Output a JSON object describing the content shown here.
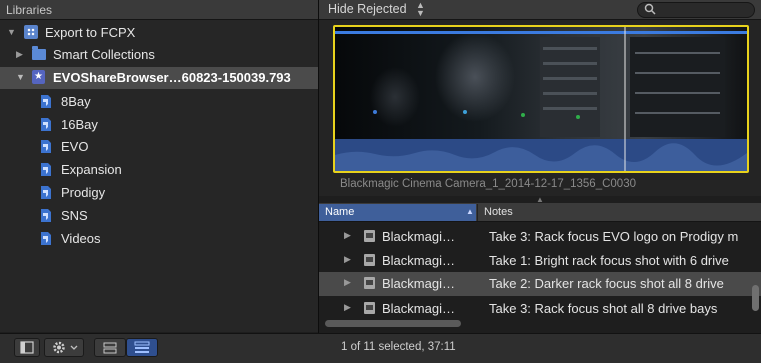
{
  "sidebar": {
    "title": "Libraries",
    "library": {
      "label": "Export to FCPX",
      "icon": "library-icon"
    },
    "smart_collections": {
      "label": "Smart Collections",
      "icon": "folder-icon"
    },
    "event": {
      "label": "EVOShareBrowser…60823-150039.793",
      "icon": "event-star-icon"
    },
    "keywords": [
      {
        "label": "8Bay"
      },
      {
        "label": "16Bay"
      },
      {
        "label": "EVO"
      },
      {
        "label": "Expansion"
      },
      {
        "label": "Prodigy"
      },
      {
        "label": "SNS"
      },
      {
        "label": "Videos"
      }
    ]
  },
  "browser": {
    "filter": "Hide Rejected",
    "search_placeholder": "",
    "clip_name": "Blackmagic Cinema Camera_1_2014-12-17_1356_C0030",
    "columns": {
      "name": "Name",
      "notes": "Notes"
    },
    "rows": [
      {
        "name": "Blackmagi…",
        "notes": "Take 3: Rack focus EVO logo on Prodigy m",
        "selected": false
      },
      {
        "name": "Blackmagi…",
        "notes": "Take 1: Bright rack focus shot with 6 drive",
        "selected": false
      },
      {
        "name": "Blackmagi…",
        "notes": "Take 2: Darker rack focus shot all 8 drive",
        "selected": true
      },
      {
        "name": "Blackmagi…",
        "notes": "Take 3: Rack focus shot all 8 drive bays",
        "selected": false
      }
    ]
  },
  "status": "1 of 11 selected, 37:11",
  "colors": {
    "accent": "#3f5f9a",
    "selection_border": "#e8d21c",
    "audio_wave": "#3d5e9c"
  }
}
